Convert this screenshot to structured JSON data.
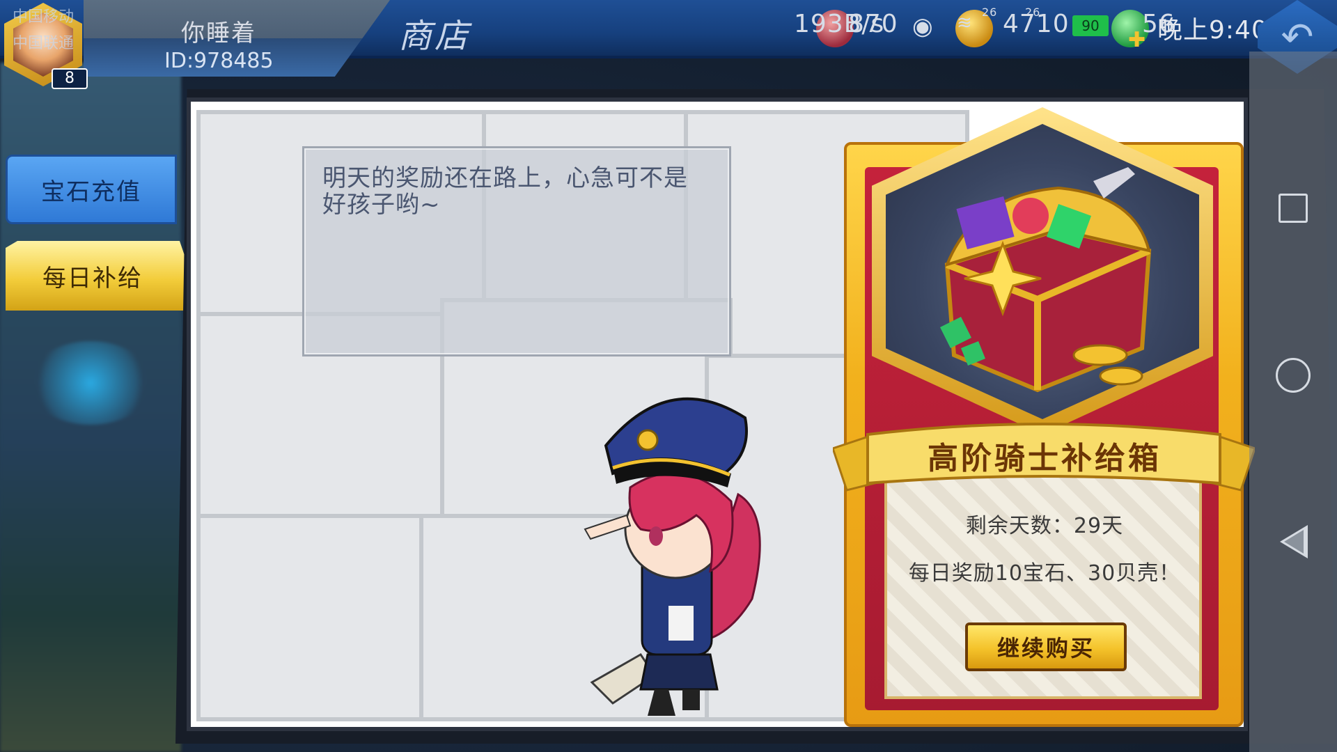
{
  "status_bar": {
    "carrier_1": "中国移动",
    "carrier_2": "中国联通",
    "network_speed": "193B/s",
    "signal_1": "26",
    "signal_2": "26",
    "battery": "90",
    "time": "晚上9:40"
  },
  "player": {
    "name": "你睡着",
    "id": "ID:978485",
    "level": "8",
    "stamina": "870",
    "coins": "4710",
    "gems": "56"
  },
  "header": {
    "title": "商店"
  },
  "sidebar": {
    "items": [
      {
        "label": "宝石充值"
      },
      {
        "label": "每日补给"
      }
    ]
  },
  "dialog": {
    "text": "明天的奖励还在路上，心急可不是好孩子哟~"
  },
  "reward_card": {
    "title": "高阶骑士补给箱",
    "remaining_days": "剩余天数：29天",
    "daily_reward": "每日奖励10宝石、30贝壳！",
    "buy_label": "继续购买"
  },
  "colors": {
    "topbar": "#1f4f95",
    "tab_active_gold": "#f3cd3b",
    "tab_blue": "#2f79d6",
    "card_gold": "#f2b11d",
    "card_red": "#c4223b"
  }
}
